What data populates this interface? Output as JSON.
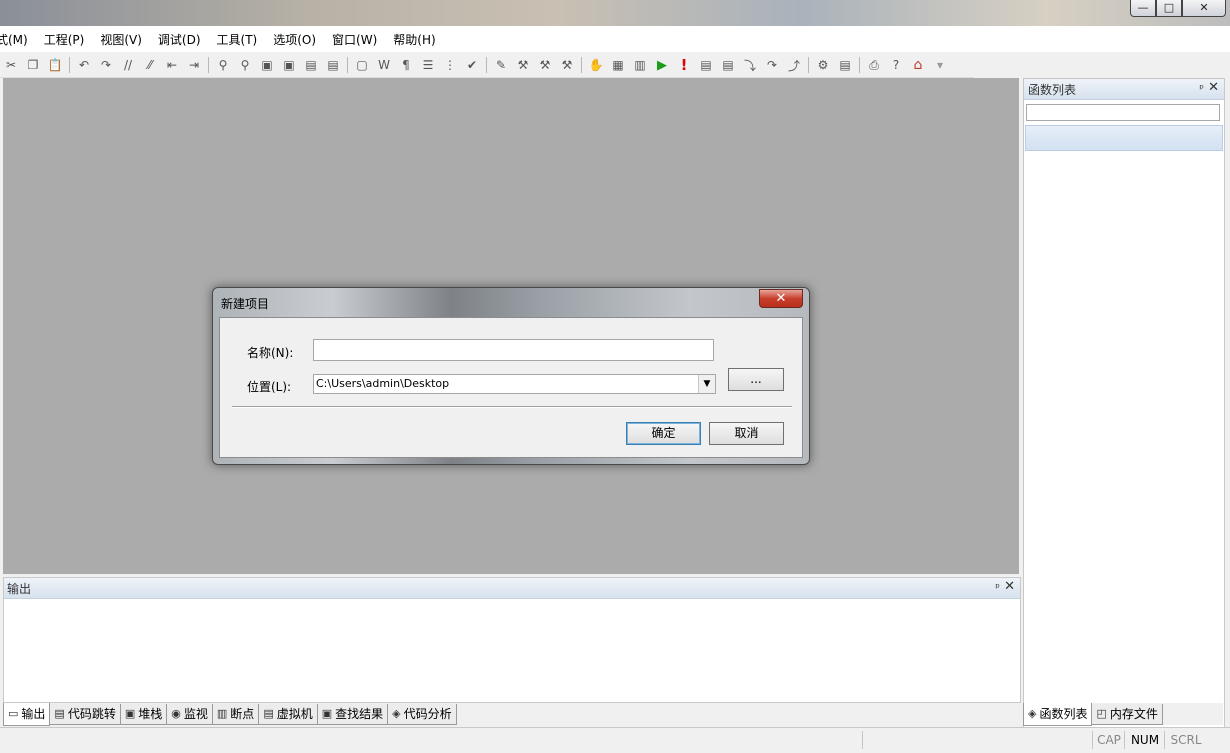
{
  "window": {
    "min_glyph": "—",
    "max_glyph": "□",
    "close_glyph": "✕"
  },
  "menu": [
    "式(M)",
    "工程(P)",
    "视图(V)",
    "调试(D)",
    "工具(T)",
    "选项(O)",
    "窗口(W)",
    "帮助(H)"
  ],
  "toolbar_icons": [
    {
      "name": "cut-icon",
      "g": "✂"
    },
    {
      "name": "copy-icon",
      "g": "❐"
    },
    {
      "name": "paste-icon",
      "g": "📋"
    },
    {
      "sep": true
    },
    {
      "name": "undo-icon",
      "g": "↶"
    },
    {
      "name": "redo-icon",
      "g": "↷"
    },
    {
      "name": "comment-icon",
      "g": "//"
    },
    {
      "name": "uncomment-icon",
      "g": "⁄⁄"
    },
    {
      "name": "indent-icon",
      "g": "⇤"
    },
    {
      "name": "outdent-icon",
      "g": "⇥"
    },
    {
      "sep": true
    },
    {
      "name": "find-icon",
      "g": "⚲"
    },
    {
      "name": "find-replace-icon",
      "g": "⚲"
    },
    {
      "name": "find-in-files-icon",
      "g": "▣"
    },
    {
      "name": "replace-in-files-icon",
      "g": "▣"
    },
    {
      "name": "bookmark-icon",
      "g": "▤"
    },
    {
      "name": "bookmark-next-icon",
      "g": "▤"
    },
    {
      "sep": true
    },
    {
      "name": "window-icon",
      "g": "▢"
    },
    {
      "name": "word-wrap-icon",
      "g": "W"
    },
    {
      "name": "paragraph-icon",
      "g": "¶"
    },
    {
      "name": "format-icon",
      "g": "☰"
    },
    {
      "name": "outline-icon",
      "g": "⋮"
    },
    {
      "name": "check-icon",
      "g": "✔"
    },
    {
      "sep": true
    },
    {
      "name": "compile-icon",
      "g": "✎"
    },
    {
      "name": "build-icon",
      "g": "⚒"
    },
    {
      "name": "rebuild-icon",
      "g": "⚒"
    },
    {
      "name": "clean-icon",
      "g": "⚒"
    },
    {
      "sep": true
    },
    {
      "name": "hand-icon",
      "g": "✋"
    },
    {
      "name": "calendar-icon",
      "g": "▦"
    },
    {
      "name": "list-icon",
      "g": "▥"
    },
    {
      "name": "run-icon",
      "g": "▶",
      "cls": "green"
    },
    {
      "name": "stop-icon",
      "g": "!",
      "cls": "red"
    },
    {
      "name": "step-icon",
      "g": "▤"
    },
    {
      "name": "step-list-icon",
      "g": "▤"
    },
    {
      "name": "step-into-icon",
      "g": "⤵"
    },
    {
      "name": "step-over-icon",
      "g": "↷"
    },
    {
      "name": "step-out-icon",
      "g": "⤴"
    },
    {
      "sep": true
    },
    {
      "name": "tool-icon",
      "g": "⚙"
    },
    {
      "name": "settings-icon",
      "g": "▤"
    },
    {
      "sep": true
    },
    {
      "name": "print-icon",
      "g": "⎙"
    },
    {
      "name": "help-icon",
      "g": "?"
    },
    {
      "name": "home-icon",
      "g": "⌂",
      "cls": "house"
    },
    {
      "name": "toolbar-more-icon",
      "g": "▾",
      "cls": "gr"
    }
  ],
  "func_panel": {
    "title": "函数列表",
    "pin": "ᵖ",
    "close": "✕",
    "tabs": [
      {
        "label": "函数列表",
        "icon": "functions-icon",
        "g": "◈"
      },
      {
        "label": "内存文件",
        "icon": "memory-file-icon",
        "g": "◰"
      }
    ]
  },
  "output_panel": {
    "title": "输出",
    "pin": "ᵖ",
    "close": "✕",
    "tabs": [
      {
        "label": "输出",
        "icon": "output-icon",
        "g": "▭",
        "active": true
      },
      {
        "label": "代码跳转",
        "icon": "code-jump-icon",
        "g": "▤"
      },
      {
        "label": "堆栈",
        "icon": "stack-icon",
        "g": "▣"
      },
      {
        "label": "监视",
        "icon": "watch-icon",
        "g": "◉"
      },
      {
        "label": "断点",
        "icon": "breakpoint-icon",
        "g": "▥"
      },
      {
        "label": "虚拟机",
        "icon": "vm-icon",
        "g": "▤"
      },
      {
        "label": "查找结果",
        "icon": "find-results-icon",
        "g": "▣"
      },
      {
        "label": "代码分析",
        "icon": "code-analysis-icon",
        "g": "◈"
      }
    ]
  },
  "status": {
    "cap": "CAP",
    "num": "NUM",
    "scrl": "SCRL"
  },
  "dialog": {
    "title": "新建项目",
    "close_glyph": "✕",
    "name_label": "名称(N):",
    "name_value": "",
    "location_label": "位置(L):",
    "location_value": "C:\\Users\\admin\\Desktop",
    "dropdown_glyph": "▼",
    "browse_label": "...",
    "ok_label": "确定",
    "cancel_label": "取消"
  }
}
